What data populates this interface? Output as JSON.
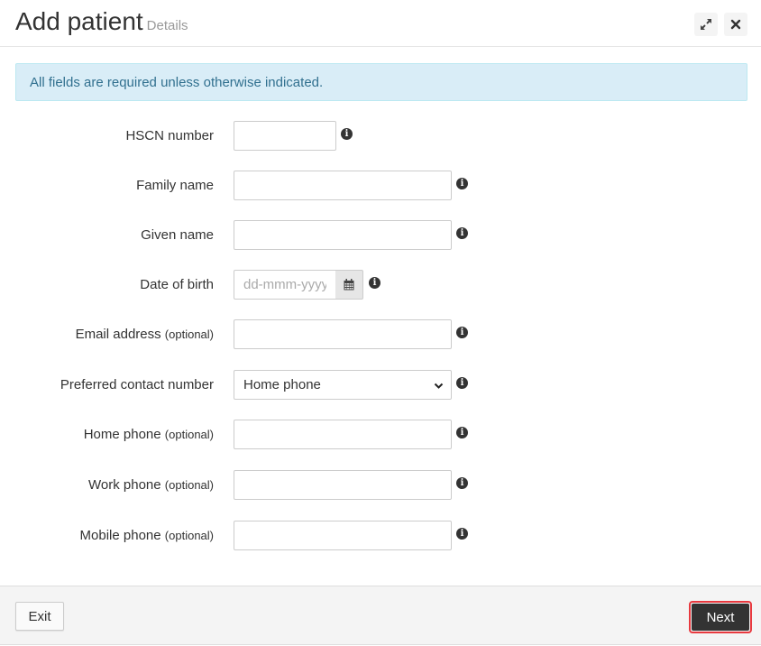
{
  "header": {
    "title": "Add patient",
    "subtitle": "Details",
    "expand_icon": "expand-icon",
    "close_icon": "close-icon"
  },
  "alert": {
    "text": "All fields are required unless otherwise indicated."
  },
  "optional_label": "(optional)",
  "form": {
    "hscn": {
      "label": "HSCN number",
      "value": ""
    },
    "family_name": {
      "label": "Family name",
      "value": ""
    },
    "given_name": {
      "label": "Given name",
      "value": ""
    },
    "dob": {
      "label": "Date of birth",
      "value": "",
      "placeholder": "dd-mmm-yyyy"
    },
    "email": {
      "label": "Email address",
      "value": ""
    },
    "preferred_contact": {
      "label": "Preferred contact number",
      "selected": "Home phone"
    },
    "home_phone": {
      "label": "Home phone",
      "value": ""
    },
    "work_phone": {
      "label": "Work phone",
      "value": ""
    },
    "mobile_phone": {
      "label": "Mobile phone",
      "value": ""
    }
  },
  "info_glyph": "i",
  "footer": {
    "exit_label": "Exit",
    "next_label": "Next"
  },
  "colors": {
    "alert_bg": "#d9edf7",
    "alert_text": "#31708f",
    "primary_button": "#333333",
    "focus_outline": "#e8393f"
  }
}
